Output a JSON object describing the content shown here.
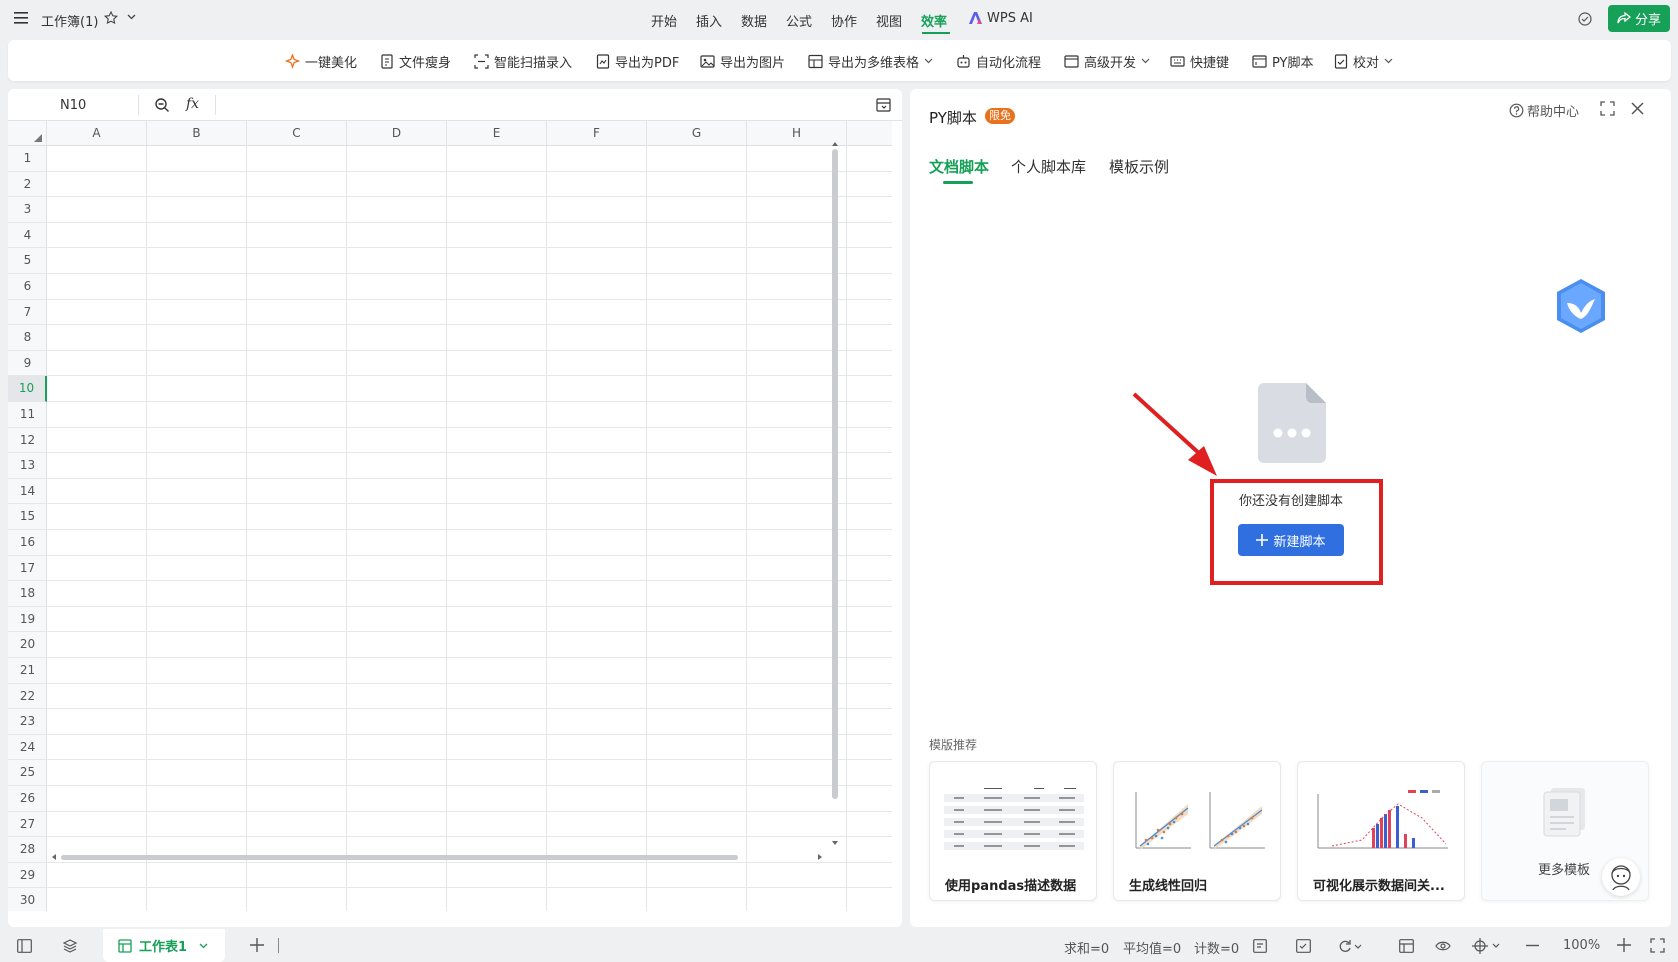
{
  "app": {
    "workbook_title": "工作簿(1)",
    "share_label": "分享",
    "colors": {
      "accent_green": "#17a058",
      "brand_blue": "#2f6fe0",
      "annotation_red": "#e02020"
    }
  },
  "menu": {
    "items": [
      "开始",
      "插入",
      "数据",
      "公式",
      "协作",
      "视图",
      "效率"
    ],
    "active": "效率",
    "ai_label": "WPS AI"
  },
  "ribbon": {
    "items": [
      {
        "label": "一键美化",
        "icon": "sparkle-icon"
      },
      {
        "label": "文件瘦身",
        "icon": "file-slim-icon"
      },
      {
        "label": "智能扫描录入",
        "icon": "scan-icon"
      },
      {
        "label": "导出为PDF",
        "icon": "pdf-icon"
      },
      {
        "label": "导出为图片",
        "icon": "image-icon"
      },
      {
        "label": "导出为多维表格",
        "icon": "table-icon"
      },
      {
        "label": "自动化流程",
        "icon": "robot-icon"
      },
      {
        "label": "高级开发",
        "icon": "window-icon"
      },
      {
        "label": "快捷键",
        "icon": "keyboard-icon"
      },
      {
        "label": "PY脚本",
        "icon": "py-icon"
      },
      {
        "label": "校对",
        "icon": "check-icon"
      }
    ]
  },
  "sheet": {
    "name_box": "N10",
    "fx": "fx",
    "columns": [
      "A",
      "B",
      "C",
      "D",
      "E",
      "F",
      "G",
      "H"
    ],
    "rows": [
      "1",
      "2",
      "3",
      "4",
      "5",
      "6",
      "7",
      "8",
      "9",
      "10",
      "11",
      "12",
      "13",
      "14",
      "15",
      "16",
      "17",
      "18",
      "19",
      "20",
      "21",
      "22",
      "23",
      "24",
      "25",
      "26",
      "27",
      "28",
      "29",
      "30"
    ],
    "active_row": "10"
  },
  "panel": {
    "title": "PY脚本",
    "badge": "限免",
    "help": "帮助中心",
    "tabs": [
      "文档脚本",
      "个人脚本库",
      "模板示例"
    ],
    "active_tab": "文档脚本",
    "empty_text": "你还没有创建脚本",
    "new_button": "新建脚本",
    "templates_heading": "模版推荐",
    "templates": [
      "使用pandas描述数据",
      "生成线性回归",
      "可视化展示数据间关...",
      "更多模板"
    ]
  },
  "status": {
    "tab_name": "工作表1",
    "sum": "求和=0",
    "avg": "平均值=0",
    "count": "计数=0",
    "zoom": "100%"
  }
}
